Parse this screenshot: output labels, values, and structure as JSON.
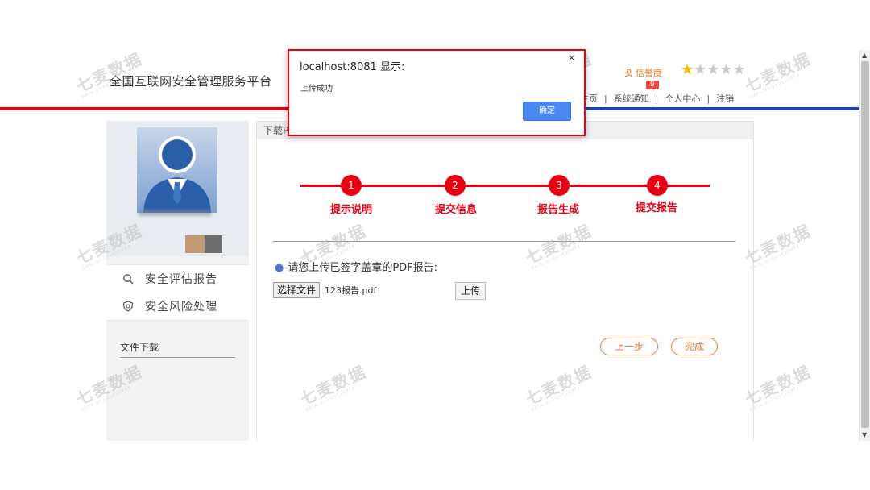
{
  "header": {
    "site_title": "全国互联网安全管理服务平台",
    "credit_label": "信誉度",
    "credit_count": "9",
    "stars": {
      "filled": 1,
      "total": 5
    },
    "nav": [
      "主页",
      "系统通知",
      "个人中心",
      "注销"
    ]
  },
  "sidebar": {
    "menu": [
      {
        "label": "安全评估报告",
        "icon": "search-icon"
      },
      {
        "label": "安全风险处理",
        "icon": "shield-icon"
      }
    ],
    "download_title": "文件下载"
  },
  "content": {
    "header_title": "下载PDF文件",
    "steps": [
      {
        "num": "1",
        "label": "提示说明"
      },
      {
        "num": "2",
        "label": "提交信息"
      },
      {
        "num": "3",
        "label": "报告生成"
      },
      {
        "num": "4",
        "label": "提交报告"
      }
    ],
    "upload_tip": "请您上传已签字盖章的PDF报告:",
    "choose_file_label": "选择文件",
    "file_name": "123报告.pdf",
    "upload_label": "上传",
    "prev_label": "上一步",
    "finish_label": "完成"
  },
  "dialog": {
    "title": "localhost:8081 显示:",
    "close": "×",
    "message": "上传成功",
    "ok_label": "确定"
  },
  "watermark": {
    "text": "七麦数据",
    "sub": "DATA-AI-DEVELOPER"
  },
  "colors": {
    "accent_red": "#e60012",
    "nav_blue": "#1b3fb8",
    "button_blue": "#4a89f2",
    "orange": "#e8723c"
  }
}
